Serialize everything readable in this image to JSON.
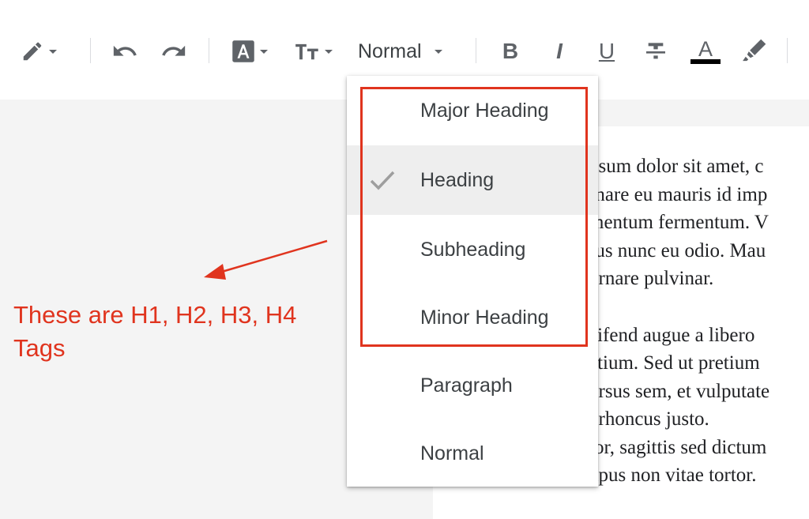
{
  "toolbar": {
    "style_selector_value": "Normal",
    "items": [
      {
        "name": "pencil-icon"
      },
      {
        "name": "undo-icon"
      },
      {
        "name": "redo-icon"
      },
      {
        "name": "text-highlight-icon"
      },
      {
        "name": "font-size-icon"
      },
      {
        "name": "bold-icon",
        "glyph": "B"
      },
      {
        "name": "italic-icon",
        "glyph": "I"
      },
      {
        "name": "underline-icon",
        "glyph": "U"
      },
      {
        "name": "strikethrough-icon"
      },
      {
        "name": "text-color-icon",
        "glyph": "A"
      },
      {
        "name": "marker-icon"
      }
    ]
  },
  "style_menu": {
    "items": [
      {
        "label": "Major Heading",
        "selected": false
      },
      {
        "label": "Heading",
        "selected": true
      },
      {
        "label": "Subheading",
        "selected": false
      },
      {
        "label": "Minor Heading",
        "selected": false
      },
      {
        "label": "Paragraph",
        "selected": false
      },
      {
        "label": "Normal",
        "selected": false
      }
    ],
    "checked_icon": "checkmark-icon"
  },
  "annotation": {
    "text_line1": "These are H1, H2, H3, H4",
    "text_line2": "Tags",
    "color": "#e0341e"
  },
  "document": {
    "paragraph1": [
      "psum dolor sit amet, c",
      "rnare eu mauris id imp",
      "mentum fermentum. V",
      "rus nunc eu odio. Mau",
      "ornare pulvinar."
    ],
    "paragraph2": [
      "eifend augue a libero",
      "etium. Sed ut pretium",
      "ursus sem, et vulputate",
      ", rhoncus justo.",
      "lor, sagittis sed dictum",
      "npus non vitae tortor."
    ]
  }
}
